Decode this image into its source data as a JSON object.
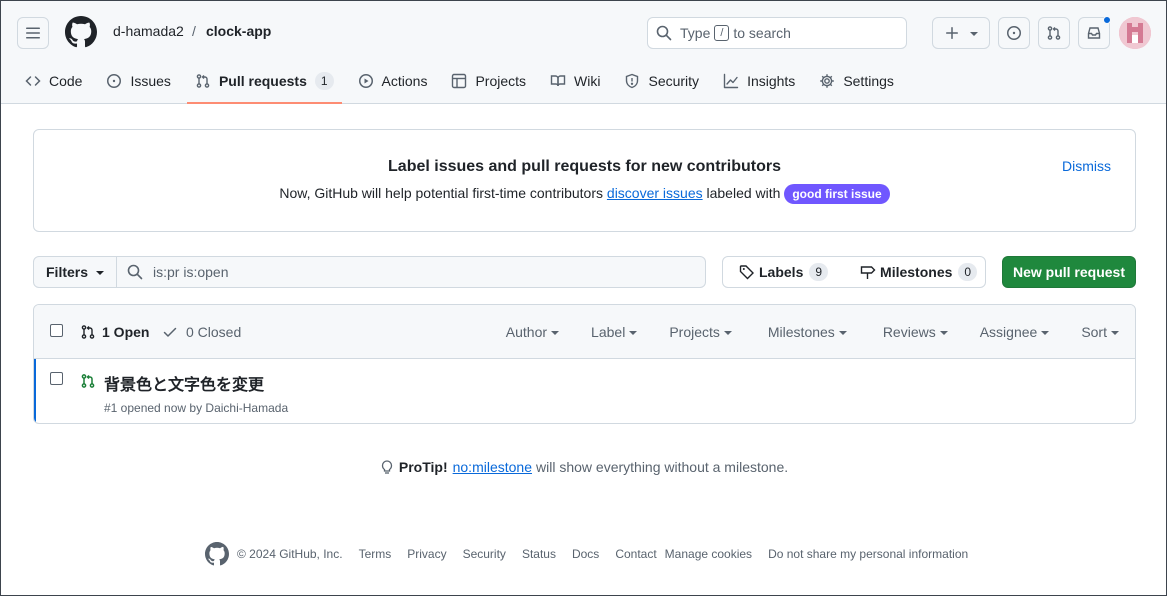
{
  "header": {
    "owner": "d-hamada2",
    "separator": "/",
    "repo": "clock-app",
    "search_prefix": "Type",
    "search_key": "/",
    "search_suffix": "to search"
  },
  "nav": {
    "items": [
      {
        "label": "Code",
        "icon": "code-icon"
      },
      {
        "label": "Issues",
        "icon": "issue-opened-icon"
      },
      {
        "label": "Pull requests",
        "icon": "git-pull-request-icon",
        "count": "1",
        "active": true
      },
      {
        "label": "Actions",
        "icon": "play-icon"
      },
      {
        "label": "Projects",
        "icon": "table-icon"
      },
      {
        "label": "Wiki",
        "icon": "book-icon"
      },
      {
        "label": "Security",
        "icon": "shield-icon"
      },
      {
        "label": "Insights",
        "icon": "graph-icon"
      },
      {
        "label": "Settings",
        "icon": "gear-icon"
      }
    ]
  },
  "banner": {
    "title": "Label issues and pull requests for new contributors",
    "body_pre": "Now, GitHub will help potential first-time contributors",
    "link": "discover issues",
    "body_post": "labeled with",
    "label": "good first issue",
    "dismiss": "Dismiss"
  },
  "toolbar": {
    "filters": "Filters",
    "query": "is:pr is:open",
    "labels": "Labels",
    "labels_count": "9",
    "milestones": "Milestones",
    "milestones_count": "0",
    "new_pr": "New pull request"
  },
  "list": {
    "open": "1 Open",
    "closed": "0 Closed",
    "sorts": [
      "Author",
      "Label",
      "Projects",
      "Milestones",
      "Reviews",
      "Assignee",
      "Sort"
    ],
    "rows": [
      {
        "title": "背景色と文字色を変更",
        "meta": "#1 opened now by Daichi-Hamada"
      }
    ]
  },
  "protip": {
    "lead": "ProTip!",
    "link": "no:milestone",
    "rest": "will show everything without a milestone."
  },
  "footer": {
    "copyright": "© 2024 GitHub, Inc.",
    "links": [
      "Terms",
      "Privacy",
      "Security",
      "Status",
      "Docs",
      "Contact",
      "Manage cookies",
      "Do not share my personal information"
    ]
  },
  "colors": {
    "accent": "#0969da",
    "primary_button": "#1f883d",
    "tab_underline": "#fd8c73",
    "open_green": "#1a7f37",
    "label_purple": "#7057ff"
  }
}
